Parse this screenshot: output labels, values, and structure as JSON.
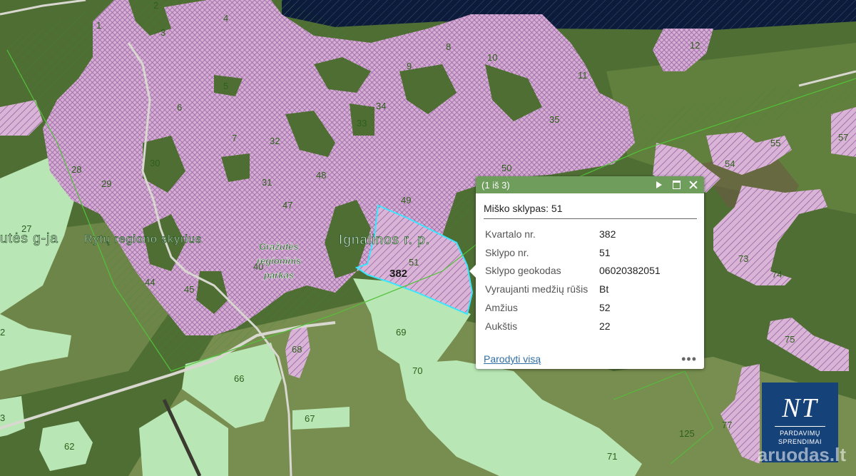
{
  "map": {
    "stand_labels": [
      "1",
      "2",
      "3",
      "4",
      "5",
      "6",
      "7",
      "8",
      "9",
      "10",
      "11",
      "12",
      "28",
      "29",
      "30",
      "31",
      "32",
      "33",
      "34",
      "35",
      "40",
      "44",
      "45",
      "47",
      "48",
      "49",
      "50",
      "51",
      "54",
      "55",
      "57",
      "62",
      "66",
      "67",
      "68",
      "69",
      "70",
      "71",
      "73",
      "74",
      "75",
      "77",
      "125"
    ],
    "edge_labels": [
      "27",
      "2",
      "3"
    ],
    "place_name": "Ignalinos r. p.",
    "place_fragment": "utės g-ja",
    "unit_name": "Rytų regiono skyrius",
    "park_name_lines": [
      "Gražutės",
      "regioninis",
      "parkas"
    ],
    "quarter_label": "382",
    "colors": {
      "protected_forest_fill": "#d9b4d6",
      "protected_hatch": "#8a5a99",
      "meadow_fill": "#b8e6b4",
      "selected_outline": "#39e6ff",
      "water": "#0d1b3a",
      "popup_header": "#6e9d5c"
    }
  },
  "popup": {
    "counter": "(1 iš 3)",
    "title": "Miško sklypas: 51",
    "attributes": [
      {
        "key": "Kvartalo nr.",
        "value": "382"
      },
      {
        "key": "Sklypo nr.",
        "value": "51"
      },
      {
        "key": "Sklypo geokodas",
        "value": "06020382051"
      },
      {
        "key": "Vyraujanti medžių rūšis",
        "value": "Bt"
      },
      {
        "key": "Amžius",
        "value": "52"
      },
      {
        "key": "Aukštis",
        "value": "22"
      }
    ],
    "show_all": "Parodyti visą",
    "more": "•••",
    "icons": [
      "play-icon",
      "maximize-icon",
      "close-icon",
      "more-icon"
    ]
  },
  "logo": {
    "mark": "NT",
    "lines": [
      "PARDAVIMŲ",
      "SPRENDIMAI"
    ]
  },
  "watermark": "aruodas.lt"
}
